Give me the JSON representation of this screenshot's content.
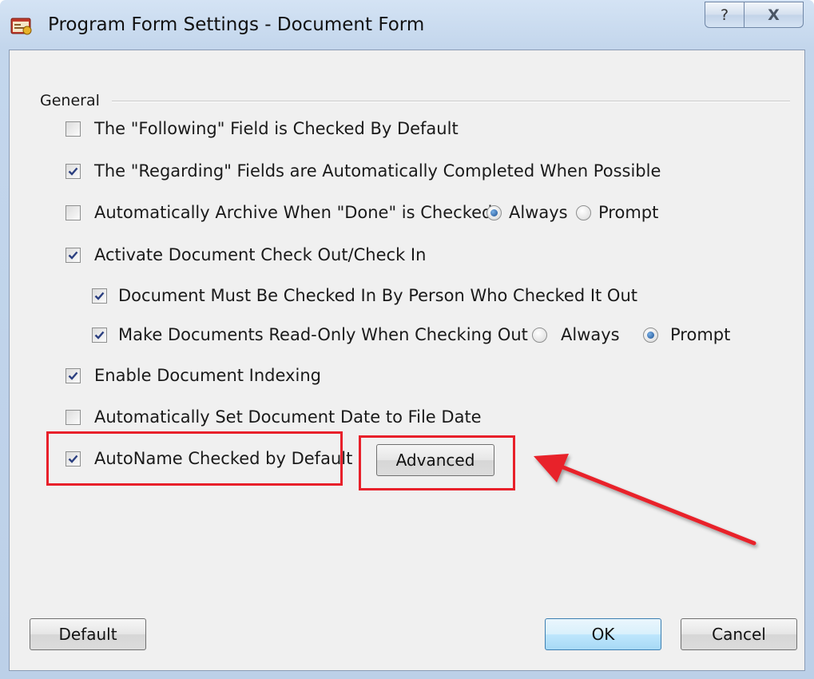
{
  "window": {
    "title": "Program Form Settings - Document Form",
    "help_label": "?",
    "close_label": "X"
  },
  "group": {
    "label": "General"
  },
  "options": {
    "following": {
      "label": "The \"Following\" Field is Checked By Default",
      "checked": false
    },
    "regarding": {
      "label": "The \"Regarding\" Fields are Automatically Completed When Possible",
      "checked": true
    },
    "archive": {
      "label": "Automatically Archive When \"Done\" is Checked",
      "checked": false,
      "radio_always": "Always",
      "radio_prompt": "Prompt",
      "selected": "Always"
    },
    "checkout": {
      "label": "Activate Document Check Out/Check In",
      "checked": true
    },
    "checkin_person": {
      "label": "Document Must Be Checked In By Person Who Checked It Out",
      "checked": true
    },
    "readonly": {
      "label": "Make Documents Read-Only When Checking Out",
      "checked": true,
      "radio_always": "Always",
      "radio_prompt": "Prompt",
      "selected": "Prompt"
    },
    "indexing": {
      "label": "Enable Document Indexing",
      "checked": true
    },
    "filedate": {
      "label": "Automatically Set Document Date to File Date",
      "checked": false
    },
    "autoname": {
      "label": "AutoName Checked by Default",
      "checked": true
    }
  },
  "buttons": {
    "advanced": "Advanced",
    "default": "Default",
    "ok": "OK",
    "cancel": "Cancel"
  },
  "colors": {
    "annotation": "#e8202a",
    "accent": "#1b4f91"
  }
}
